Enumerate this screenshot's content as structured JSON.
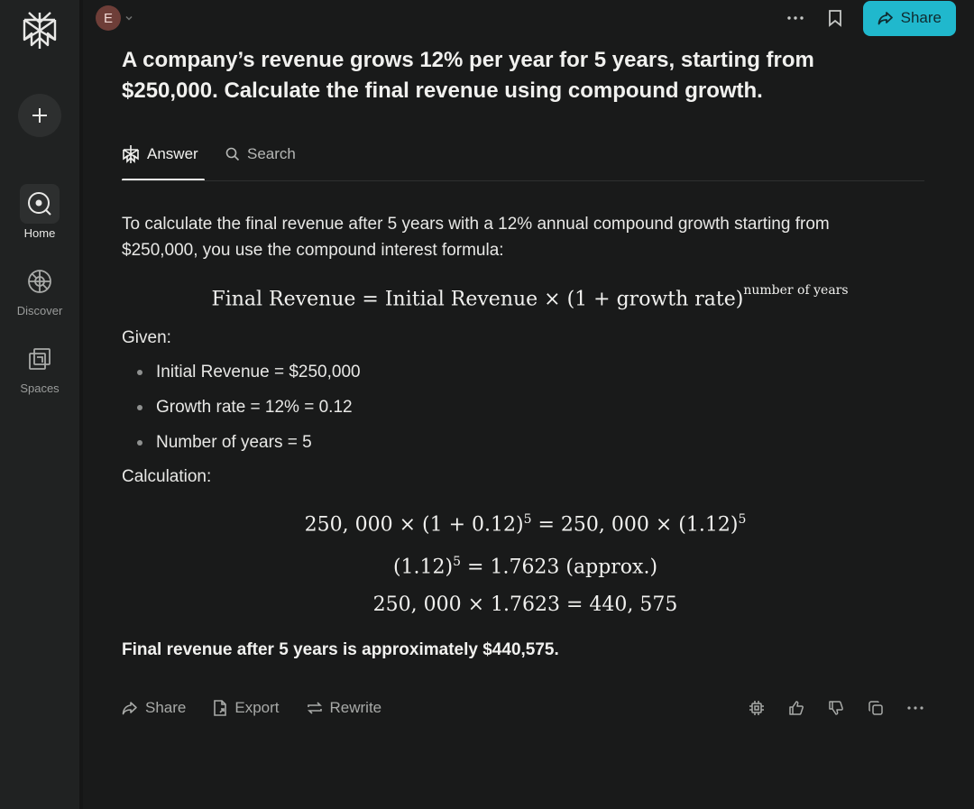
{
  "sidebar": {
    "items": [
      {
        "label": "Home",
        "icon": "home-icon",
        "active": true
      },
      {
        "label": "Discover",
        "icon": "discover-icon",
        "active": false
      },
      {
        "label": "Spaces",
        "icon": "spaces-icon",
        "active": false
      }
    ]
  },
  "header": {
    "avatar_letter": "E",
    "share_label": "Share"
  },
  "question": "A company’s revenue grows 12% per year for 5 years, starting from $250,000. Calculate the final revenue using compound growth.",
  "tabs": [
    {
      "label": "Answer",
      "active": true
    },
    {
      "label": "Search",
      "active": false
    }
  ],
  "answer": {
    "intro": "To calculate the final revenue after 5 years with a 12% annual compound growth starting from $250,000, you use the compound interest formula:",
    "formula": {
      "base": "Final Revenue = Initial Revenue × (1 + growth rate)",
      "exponent": "number of years"
    },
    "given_label": "Given:",
    "given": [
      "Initial Revenue = $250,000",
      "Growth rate = 12% = 0.12",
      "Number of years = 5"
    ],
    "calc_label": "Calculation:",
    "calc_lines": [
      {
        "a": "250, 000 × (1 + 0.12)",
        "a_exp": "5",
        "b": " = 250, 000 × (1.12)",
        "b_exp": "5"
      },
      {
        "a": "(1.12)",
        "a_exp": "5",
        "b": " = 1.7623 (approx.)",
        "b_exp": ""
      },
      {
        "a": "250, 000 × 1.7623 = 440, 575",
        "a_exp": "",
        "b": "",
        "b_exp": ""
      }
    ],
    "final": "Final revenue after 5 years is approximately $440,575."
  },
  "actions": {
    "share": "Share",
    "export": "Export",
    "rewrite": "Rewrite"
  },
  "colors": {
    "accent": "#20b8cd",
    "background": "#191a1a",
    "sidebar": "#202222"
  }
}
